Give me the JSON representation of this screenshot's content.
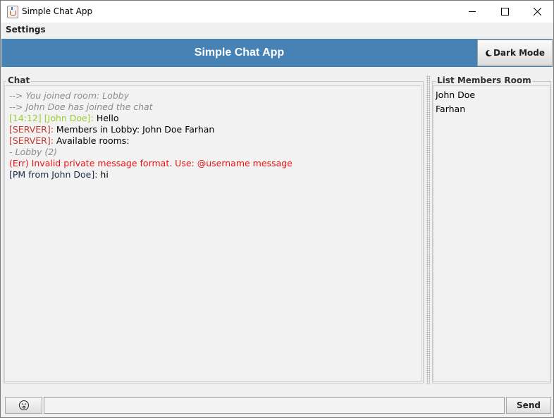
{
  "window": {
    "title": "Simple Chat App"
  },
  "menu": {
    "settings_label": "Settings"
  },
  "header": {
    "title": "Simple Chat App",
    "dark_mode_label": "Dark Mode",
    "background_color": "#4682b4"
  },
  "chat": {
    "legend": "Chat",
    "lines": {
      "joined_room": "--> You joined room: Lobby",
      "john_joined": "--> John Doe has joined the chat",
      "hello_prefix": "[14:12] [John Doe]:",
      "hello_text": " Hello",
      "members_prefix": "[SERVER]:",
      "members_text": " Members in Lobby:  John Doe Farhan",
      "rooms_prefix": "[SERVER]:",
      "rooms_text": " Available rooms:",
      "room_item": "- Lobby (2)",
      "error_text": "(Err) Invalid private message format. Use: @username message",
      "pm_prefix": "[PM from John Doe]:",
      "pm_text": " hi"
    },
    "colors": {
      "system": "#8c8c8c",
      "user_prefix": "#9acd32",
      "server_prefix": "#c0392b",
      "error": "#ee1111",
      "pm_prefix": "#1a2a44"
    }
  },
  "members": {
    "legend": "List Members Room",
    "items": [
      "John Doe",
      "Farhan"
    ]
  },
  "input": {
    "value": "",
    "send_label": "Send",
    "emoji_icon": "smiley-face-icon"
  }
}
